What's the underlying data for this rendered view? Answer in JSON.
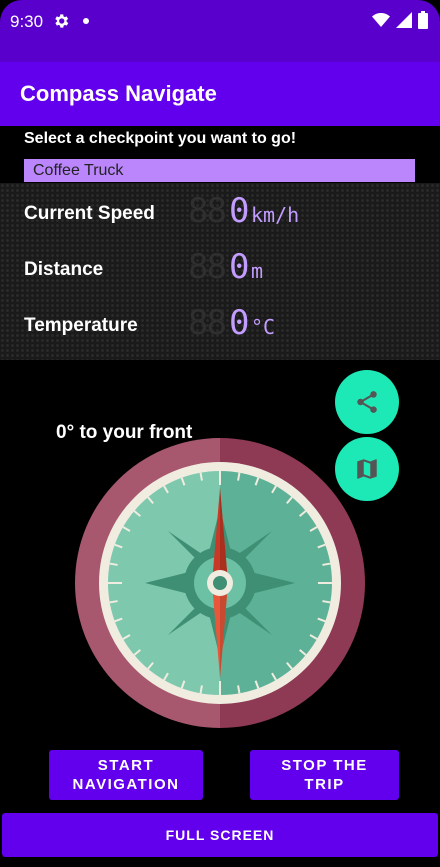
{
  "status_bar": {
    "time": "9:30",
    "icons": [
      "gear-icon",
      "notification-dot",
      "wifi-icon",
      "signal-icon",
      "battery-icon"
    ]
  },
  "app_bar": {
    "title": "Compass Navigate"
  },
  "checkpoint": {
    "prompt": "Select a checkpoint you want to go!",
    "selected": "Coffee Truck"
  },
  "readouts": {
    "speed": {
      "label": "Current Speed",
      "ghost": "88",
      "value": "0",
      "unit": "km/h"
    },
    "distance": {
      "label": "Distance",
      "ghost": "88",
      "value": "0",
      "unit": "m"
    },
    "temperature": {
      "label": "Temperature",
      "ghost": "88",
      "value": "0",
      "unit": "°C"
    }
  },
  "compass": {
    "heading_text": "0° to your front",
    "heading_degrees": 0
  },
  "fabs": {
    "share": "share-icon",
    "map": "map-icon"
  },
  "buttons": {
    "start_line1": "START",
    "start_line2": "NAVIGATION",
    "stop_line1": "STOP THE",
    "stop_line2": "TRIP",
    "full_screen": "FULL SCREEN"
  },
  "colors": {
    "status_bar": "#5a00cc",
    "app_bar": "#6200ee",
    "accent": "#bb86fc",
    "fab": "#1de9b6",
    "led": "#c39cff"
  }
}
